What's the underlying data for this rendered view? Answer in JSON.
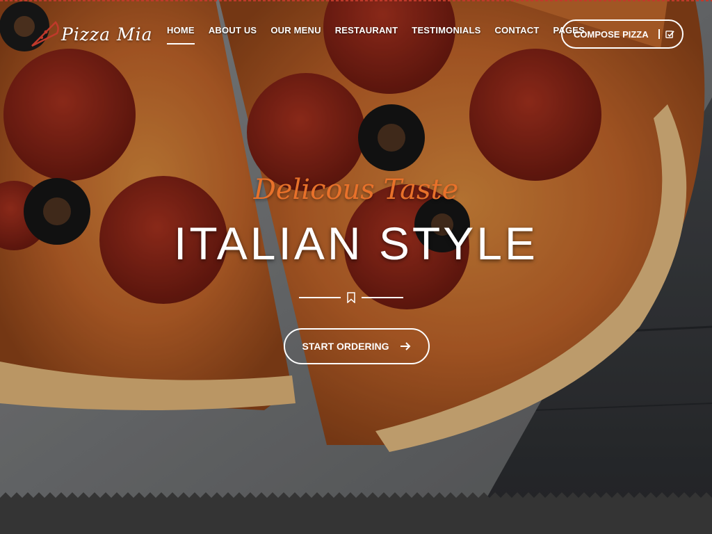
{
  "brand": {
    "name": "Pizza Mia",
    "accent_color": "#e8712a",
    "logo_color": "#c0392b"
  },
  "nav": {
    "items": [
      {
        "label": "HOME",
        "active": true
      },
      {
        "label": "ABOUT US",
        "active": false
      },
      {
        "label": "OUR MENU",
        "active": false
      },
      {
        "label": "RESTAURANT",
        "active": false
      },
      {
        "label": "TESTIMONIALS",
        "active": false
      },
      {
        "label": "CONTACT",
        "active": false
      },
      {
        "label": "PAGES",
        "active": false
      }
    ],
    "compose_button": {
      "label": "COMPOSE PIZZA",
      "icon": "check-square-icon"
    }
  },
  "hero": {
    "tagline": "Delicous Taste",
    "headline": "ITALIAN STYLE",
    "divider_icon": "bookmark-icon",
    "cta": {
      "label": "START ORDERING",
      "icon": "arrow-right-icon"
    },
    "background": "pepperoni-pizza-photo"
  }
}
